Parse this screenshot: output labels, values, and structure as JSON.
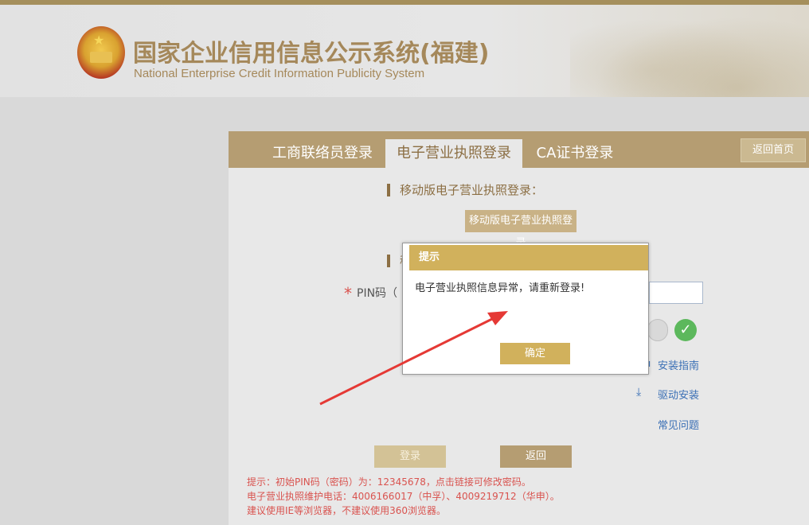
{
  "header": {
    "title_cn": "国家企业信用信息公示系统(福建)",
    "title_en": "National Enterprise Credit Information Publicity System"
  },
  "tabs": [
    {
      "label": "工商联络员登录"
    },
    {
      "label": "电子营业执照登录",
      "active": true
    },
    {
      "label": "CA证书登录"
    }
  ],
  "back_home_label": "返回首页",
  "mobile_section": {
    "title": "移动版电子营业执照登录：",
    "button_label": "移动版电子营业执照登录"
  },
  "second_section": {
    "title": "移"
  },
  "pin": {
    "label": "PIN码（"
  },
  "side_links": {
    "install_guide": "安装指南",
    "driver_install": "驱动安装",
    "faq": "常见问题"
  },
  "buttons": {
    "login": "登录",
    "back": "返回"
  },
  "notes": [
    "提示：初始PIN码（密码）为：12345678，点击链接可修改密码。",
    "电子营业执照维护电话：4006166017（中孚）、4009219712（华申）。",
    "建议使用IE等浏览器，不建议使用360浏览器。"
  ],
  "dialog": {
    "title": "提示",
    "message": "电子营业执照信息异常，请重新登录!",
    "ok_label": "确定"
  },
  "colors": {
    "brand_gold": "#b59d72",
    "dialog_gold": "#d1b15c",
    "note_red": "#d9534f",
    "link_blue": "#3a6fb5",
    "arrow_red": "#e53935"
  }
}
